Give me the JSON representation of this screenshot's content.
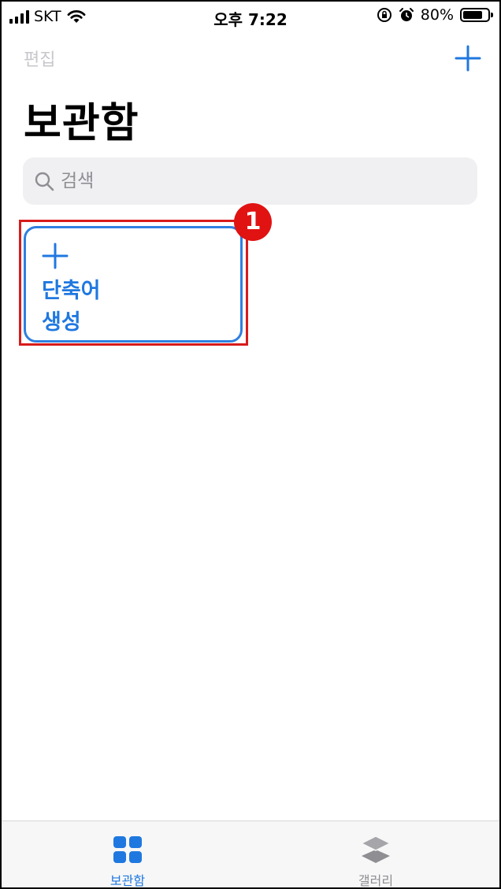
{
  "status_bar": {
    "carrier": "SKT",
    "time": "오후 7:22",
    "battery_percent": "80%",
    "battery_level": 0.8
  },
  "nav": {
    "edit_label": "편집",
    "add_icon": "plus-icon"
  },
  "page": {
    "title": "보관함"
  },
  "search": {
    "placeholder": "검색",
    "value": ""
  },
  "create_tile": {
    "line1": "단축어",
    "line2": "생성"
  },
  "annotation": {
    "step_number": "1",
    "highlight_color": "#d81b1b"
  },
  "tab_bar": {
    "tabs": [
      {
        "label": "보관함",
        "icon": "grid-icon",
        "active": true
      },
      {
        "label": "갤러리",
        "icon": "layers-icon",
        "active": false
      }
    ]
  },
  "colors": {
    "accent": "#1f78e0",
    "inactive": "#8e8e93"
  }
}
